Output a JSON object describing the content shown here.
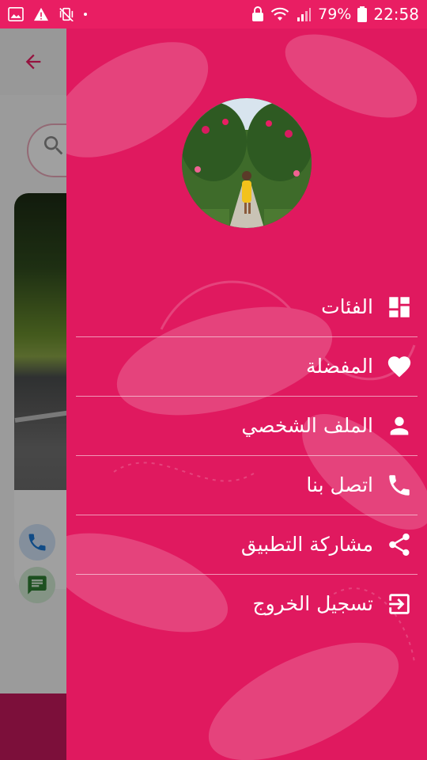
{
  "status_bar": {
    "battery_percent": "79%",
    "time": "22:58",
    "icons": [
      "image-icon",
      "warning-icon",
      "vibrate-off-icon",
      "lock-icon",
      "wifi-icon",
      "signal-icon",
      "battery-icon"
    ]
  },
  "colors": {
    "accent": "#e91e63",
    "drawer": "#e0195f",
    "bottom_bar": "#c2185b"
  },
  "drawer": {
    "menu": [
      {
        "label": "الفئات",
        "icon": "dashboard-icon"
      },
      {
        "label": "المفضلة",
        "icon": "heart-icon"
      },
      {
        "label": "الملف الشخصي",
        "icon": "person-icon"
      },
      {
        "label": "اتصل بنا",
        "icon": "phone-icon"
      },
      {
        "label": "مشاركة التطبيق",
        "icon": "share-icon"
      },
      {
        "label": "تسجيل الخروج",
        "icon": "logout-icon"
      }
    ]
  }
}
